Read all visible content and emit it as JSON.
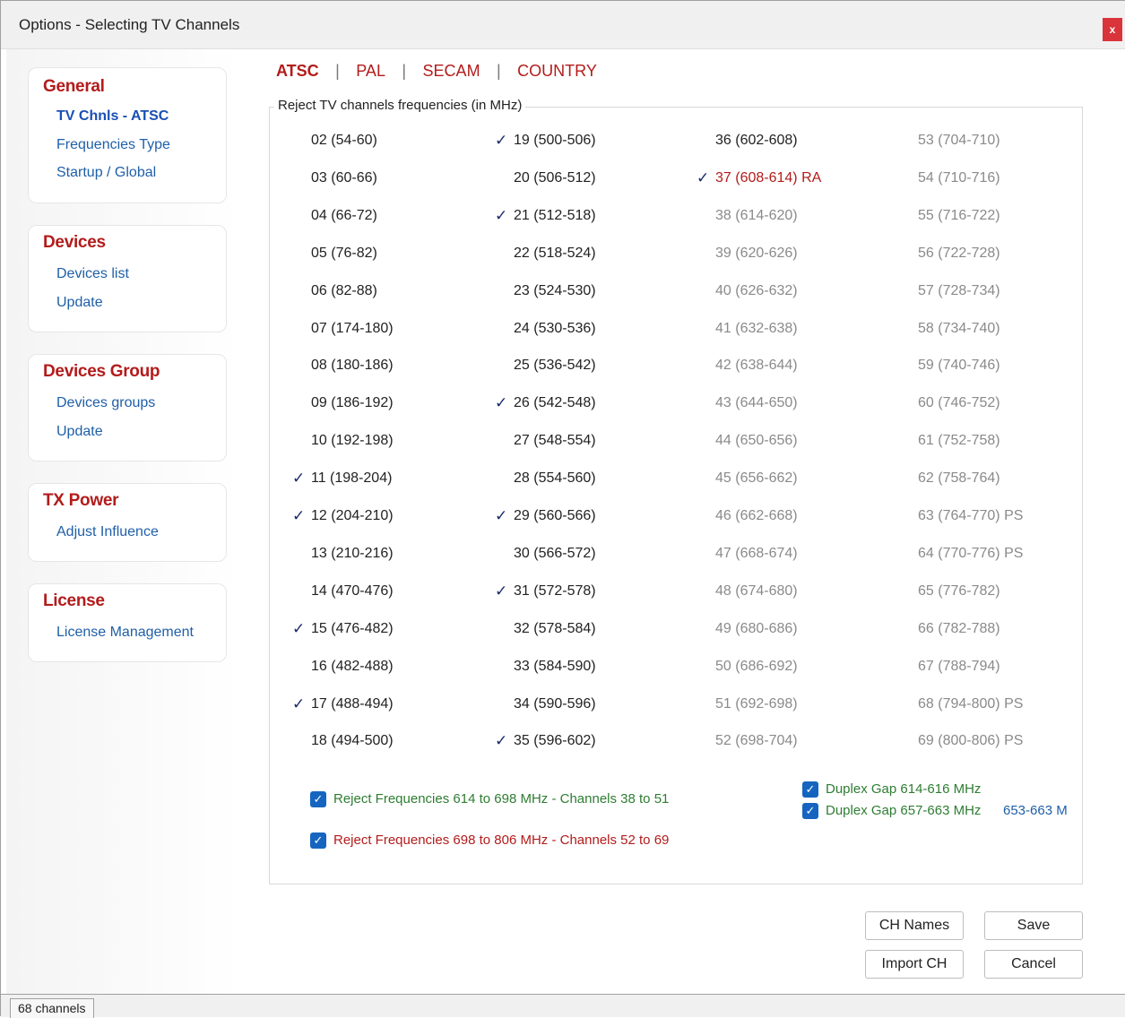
{
  "window": {
    "title": "Options - Selecting TV Channels",
    "close_label": "x"
  },
  "nav": {
    "general": {
      "heading": "General",
      "items": [
        "TV Chnls - ATSC",
        "Frequencies Type",
        "Startup / Global"
      ]
    },
    "devices": {
      "heading": "Devices",
      "items": [
        "Devices list",
        "Update"
      ]
    },
    "devices_group": {
      "heading": "Devices Group",
      "items": [
        "Devices groups",
        "Update"
      ]
    },
    "tx_power": {
      "heading": "TX Power",
      "items": [
        "Adjust Influence"
      ]
    },
    "license": {
      "heading": "License",
      "items": [
        "License Management"
      ]
    }
  },
  "tabs": [
    "ATSC",
    "PAL",
    "SECAM",
    "COUNTRY"
  ],
  "active_tab": "ATSC",
  "group_label": "Reject TV channels frequencies (in MHz)",
  "check_glyph": "✓",
  "channels": [
    {
      "label": "02 (54-60)",
      "checked": false,
      "state": "normal"
    },
    {
      "label": "03 (60-66)",
      "checked": false,
      "state": "normal"
    },
    {
      "label": "04 (66-72)",
      "checked": false,
      "state": "normal"
    },
    {
      "label": "05 (76-82)",
      "checked": false,
      "state": "normal"
    },
    {
      "label": "06 (82-88)",
      "checked": false,
      "state": "normal"
    },
    {
      "label": "07 (174-180)",
      "checked": false,
      "state": "normal"
    },
    {
      "label": "08 (180-186)",
      "checked": false,
      "state": "normal"
    },
    {
      "label": "09 (186-192)",
      "checked": false,
      "state": "normal"
    },
    {
      "label": "10 (192-198)",
      "checked": false,
      "state": "normal"
    },
    {
      "label": "11 (198-204)",
      "checked": true,
      "state": "normal"
    },
    {
      "label": "12 (204-210)",
      "checked": true,
      "state": "normal"
    },
    {
      "label": "13 (210-216)",
      "checked": false,
      "state": "normal"
    },
    {
      "label": "14 (470-476)",
      "checked": false,
      "state": "normal"
    },
    {
      "label": "15 (476-482)",
      "checked": true,
      "state": "normal"
    },
    {
      "label": "16 (482-488)",
      "checked": false,
      "state": "normal"
    },
    {
      "label": "17 (488-494)",
      "checked": true,
      "state": "normal"
    },
    {
      "label": "18 (494-500)",
      "checked": false,
      "state": "normal"
    },
    {
      "label": "19 (500-506)",
      "checked": true,
      "state": "normal"
    },
    {
      "label": "20 (506-512)",
      "checked": false,
      "state": "normal"
    },
    {
      "label": "21 (512-518)",
      "checked": true,
      "state": "normal"
    },
    {
      "label": "22 (518-524)",
      "checked": false,
      "state": "normal"
    },
    {
      "label": "23 (524-530)",
      "checked": false,
      "state": "normal"
    },
    {
      "label": "24 (530-536)",
      "checked": false,
      "state": "normal"
    },
    {
      "label": "25 (536-542)",
      "checked": false,
      "state": "normal"
    },
    {
      "label": "26 (542-548)",
      "checked": true,
      "state": "normal"
    },
    {
      "label": "27 (548-554)",
      "checked": false,
      "state": "normal"
    },
    {
      "label": "28 (554-560)",
      "checked": false,
      "state": "normal"
    },
    {
      "label": "29 (560-566)",
      "checked": true,
      "state": "normal"
    },
    {
      "label": "30 (566-572)",
      "checked": false,
      "state": "normal"
    },
    {
      "label": "31 (572-578)",
      "checked": true,
      "state": "normal"
    },
    {
      "label": "32 (578-584)",
      "checked": false,
      "state": "normal"
    },
    {
      "label": "33 (584-590)",
      "checked": false,
      "state": "normal"
    },
    {
      "label": "34 (590-596)",
      "checked": false,
      "state": "normal"
    },
    {
      "label": "35 (596-602)",
      "checked": true,
      "state": "normal"
    },
    {
      "label": "36 (602-608)",
      "checked": false,
      "state": "normal"
    },
    {
      "label": "37 (608-614) RA",
      "checked": true,
      "state": "red"
    },
    {
      "label": "38 (614-620)",
      "checked": false,
      "state": "gray"
    },
    {
      "label": "39 (620-626)",
      "checked": false,
      "state": "gray"
    },
    {
      "label": "40 (626-632)",
      "checked": false,
      "state": "gray"
    },
    {
      "label": "41 (632-638)",
      "checked": false,
      "state": "gray"
    },
    {
      "label": "42 (638-644)",
      "checked": false,
      "state": "gray"
    },
    {
      "label": "43 (644-650)",
      "checked": false,
      "state": "gray"
    },
    {
      "label": "44 (650-656)",
      "checked": false,
      "state": "gray"
    },
    {
      "label": "45 (656-662)",
      "checked": false,
      "state": "gray"
    },
    {
      "label": "46 (662-668)",
      "checked": false,
      "state": "gray"
    },
    {
      "label": "47 (668-674)",
      "checked": false,
      "state": "gray"
    },
    {
      "label": "48 (674-680)",
      "checked": false,
      "state": "gray"
    },
    {
      "label": "49 (680-686)",
      "checked": false,
      "state": "gray"
    },
    {
      "label": "50 (686-692)",
      "checked": false,
      "state": "gray"
    },
    {
      "label": "51 (692-698)",
      "checked": false,
      "state": "gray"
    },
    {
      "label": "52 (698-704)",
      "checked": false,
      "state": "gray"
    },
    {
      "label": "53 (704-710)",
      "checked": false,
      "state": "gray"
    },
    {
      "label": "54 (710-716)",
      "checked": false,
      "state": "gray"
    },
    {
      "label": "55 (716-722)",
      "checked": false,
      "state": "gray"
    },
    {
      "label": "56 (722-728)",
      "checked": false,
      "state": "gray"
    },
    {
      "label": "57 (728-734)",
      "checked": false,
      "state": "gray"
    },
    {
      "label": "58 (734-740)",
      "checked": false,
      "state": "gray"
    },
    {
      "label": "59 (740-746)",
      "checked": false,
      "state": "gray"
    },
    {
      "label": "60 (746-752)",
      "checked": false,
      "state": "gray"
    },
    {
      "label": "61 (752-758)",
      "checked": false,
      "state": "gray"
    },
    {
      "label": "62 (758-764)",
      "checked": false,
      "state": "gray"
    },
    {
      "label": "63 (764-770) PS",
      "checked": false,
      "state": "gray"
    },
    {
      "label": "64 (770-776) PS",
      "checked": false,
      "state": "gray"
    },
    {
      "label": "65 (776-782)",
      "checked": false,
      "state": "gray"
    },
    {
      "label": "66 (782-788)",
      "checked": false,
      "state": "gray"
    },
    {
      "label": "67 (788-794)",
      "checked": false,
      "state": "gray"
    },
    {
      "label": "68 (794-800) PS",
      "checked": false,
      "state": "gray"
    },
    {
      "label": "69 (800-806) PS",
      "checked": false,
      "state": "gray"
    }
  ],
  "options": {
    "reject_38_51": {
      "label": "Reject Frequencies 614 to 698 MHz - Channels 38 to 51",
      "checked": true
    },
    "reject_52_69": {
      "label": "Reject Frequencies 698 to 806 MHz - Channels 52 to 69",
      "checked": true
    },
    "duplex_614": {
      "label": "Duplex Gap 614-616 MHz",
      "checked": true
    },
    "duplex_657": {
      "label": "Duplex Gap 657-663 MHz",
      "checked": true,
      "extra": "653-663 M"
    }
  },
  "buttons": {
    "ch_names": "CH Names",
    "save": "Save",
    "import_ch": "Import CH",
    "cancel": "Cancel"
  },
  "status": {
    "channels": "68 channels"
  },
  "colors": {
    "accent_red": "#b31b1b",
    "link_blue": "#1f5fa8",
    "green": "#2e7d32",
    "checkbox_blue": "#1565c0"
  }
}
